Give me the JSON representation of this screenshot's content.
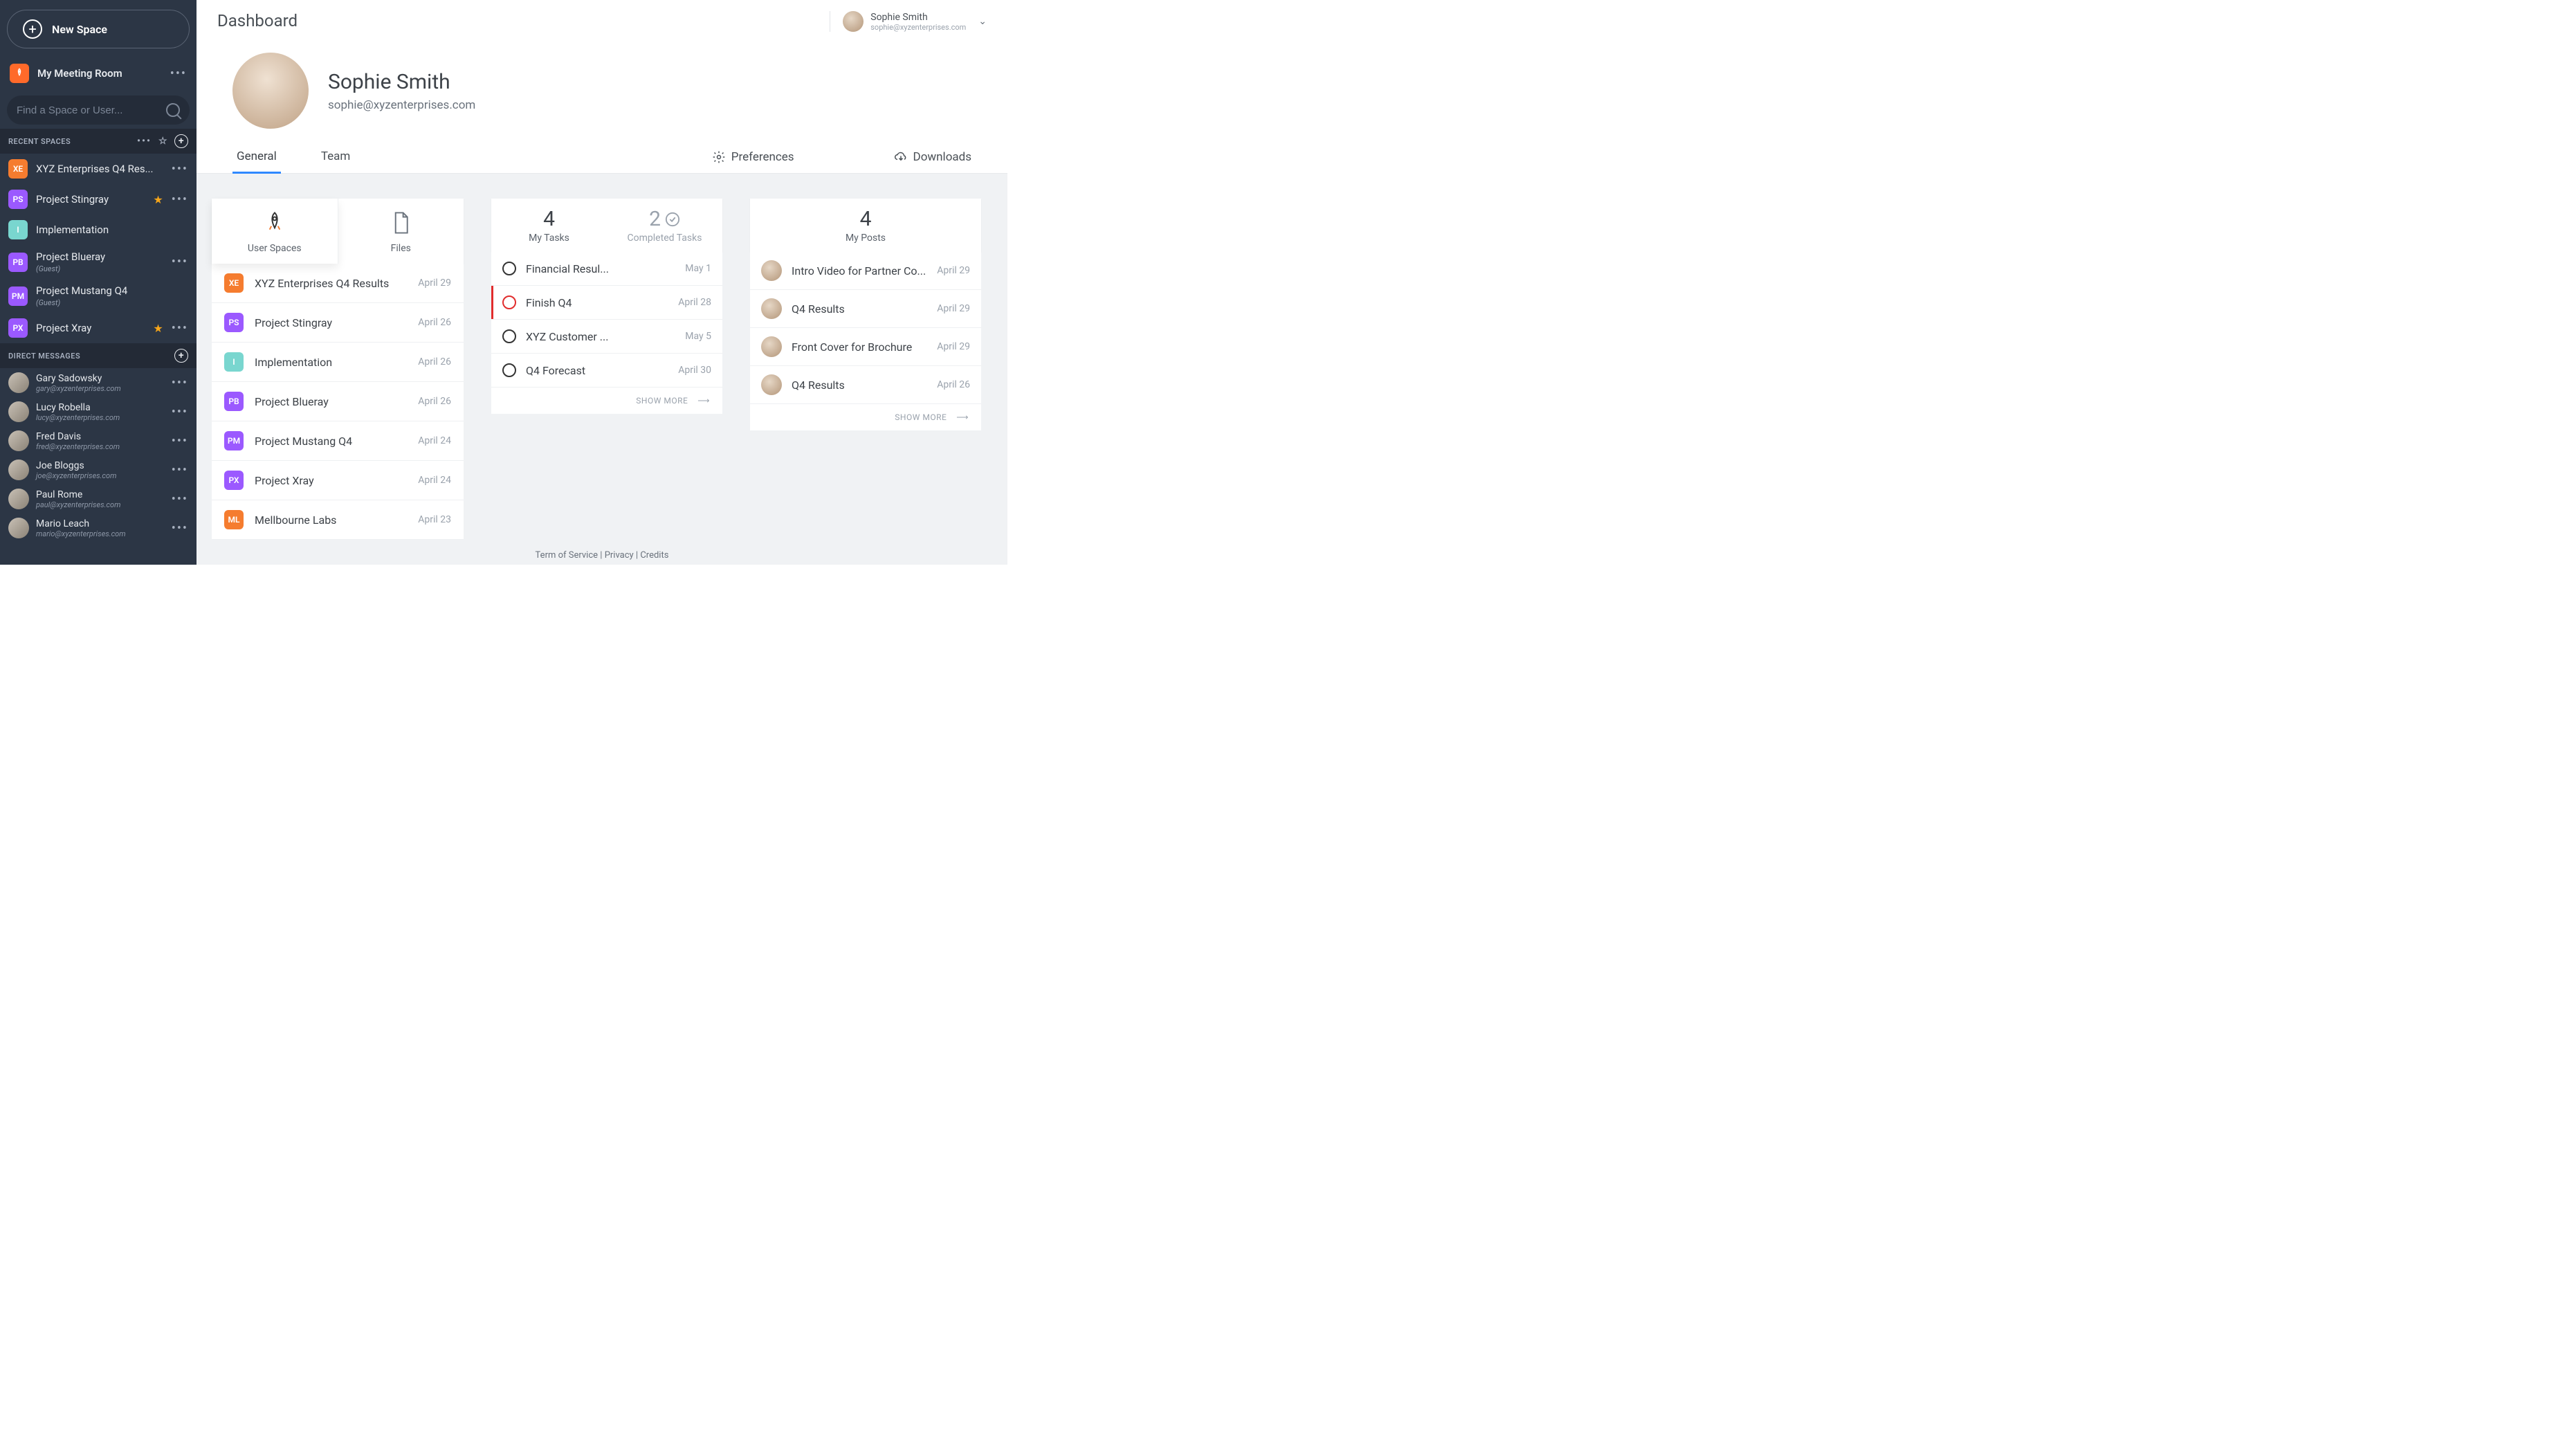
{
  "sidebar": {
    "new_space_label": "New Space",
    "my_meeting_room": "My Meeting Room",
    "search_placeholder": "Find a Space or User...",
    "recent_header": "RECENT SPACES",
    "dm_header": "DIRECT MESSAGES",
    "spaces": [
      {
        "code": "XE",
        "color": "#f57c2f",
        "name": "XYZ Enterprises Q4 Res...",
        "starred": false,
        "guest": false,
        "menu": true
      },
      {
        "code": "PS",
        "color": "#9b59ff",
        "name": "Project Stingray",
        "starred": true,
        "guest": false,
        "menu": true
      },
      {
        "code": "I",
        "color": "#79d6cf",
        "name": "Implementation",
        "starred": false,
        "guest": false,
        "menu": false
      },
      {
        "code": "PB",
        "color": "#9b59ff",
        "name": "Project Blueray",
        "starred": false,
        "guest": true,
        "menu": true
      },
      {
        "code": "PM",
        "color": "#9b59ff",
        "name": "Project Mustang Q4",
        "starred": false,
        "guest": true,
        "menu": false
      },
      {
        "code": "PX",
        "color": "#9b59ff",
        "name": "Project Xray",
        "starred": true,
        "guest": false,
        "menu": true
      }
    ],
    "guest_label": "(Guest)",
    "dms": [
      {
        "name": "Gary Sadowsky",
        "email": "gary@xyzenterprises.com"
      },
      {
        "name": "Lucy Robella",
        "email": "lucy@xyzenterprises.com"
      },
      {
        "name": "Fred Davis",
        "email": "fred@xyzenterprises.com"
      },
      {
        "name": "Joe Bloggs",
        "email": "joe@xyzenterprises.com"
      },
      {
        "name": "Paul Rome",
        "email": "paul@xyzenterprises.com"
      },
      {
        "name": "Mario Leach",
        "email": "mario@xyzenterprises.com"
      }
    ]
  },
  "header": {
    "page_title": "Dashboard",
    "user": {
      "name": "Sophie Smith",
      "email": "sophie@xyzenterprises.com"
    }
  },
  "profile": {
    "name": "Sophie Smith",
    "email": "sophie@xyzenterprises.com"
  },
  "tabs": {
    "general": "General",
    "team": "Team",
    "preferences": "Preferences",
    "downloads": "Downloads"
  },
  "col1": {
    "user_spaces_caption": "User Spaces",
    "files_caption": "Files",
    "rows": [
      {
        "code": "XE",
        "color": "#f57c2f",
        "name": "XYZ Enterprises Q4 Results",
        "date": "April 29"
      },
      {
        "code": "PS",
        "color": "#9b59ff",
        "name": "Project Stingray",
        "date": "April 26"
      },
      {
        "code": "I",
        "color": "#79d6cf",
        "name": "Implementation",
        "date": "April 26"
      },
      {
        "code": "PB",
        "color": "#9b59ff",
        "name": "Project Blueray",
        "date": "April 26"
      },
      {
        "code": "PM",
        "color": "#9b59ff",
        "name": "Project Mustang Q4",
        "date": "April 24"
      },
      {
        "code": "PX",
        "color": "#9b59ff",
        "name": "Project Xray",
        "date": "April 24"
      },
      {
        "code": "ML",
        "color": "#f57c2f",
        "name": "Mellbourne Labs",
        "date": "April 23"
      }
    ]
  },
  "col2": {
    "my_tasks_count": "4",
    "my_tasks_caption": "My Tasks",
    "completed_count": "2",
    "completed_caption": "Completed Tasks",
    "tasks": [
      {
        "name": "Financial Resul...",
        "date": "May 1",
        "hot": false
      },
      {
        "name": "Finish Q4",
        "date": "April 28",
        "hot": true
      },
      {
        "name": "XYZ Customer ...",
        "date": "May 5",
        "hot": false
      },
      {
        "name": "Q4 Forecast",
        "date": "April 30",
        "hot": false
      }
    ],
    "show_more": "SHOW MORE"
  },
  "col3": {
    "count": "4",
    "caption": "My Posts",
    "posts": [
      {
        "name": "Intro Video for Partner Co...",
        "date": "April 29"
      },
      {
        "name": "Q4 Results",
        "date": "April 29"
      },
      {
        "name": "Front Cover for Brochure",
        "date": "April 29"
      },
      {
        "name": "Q4 Results",
        "date": "April 26"
      }
    ],
    "show_more": "SHOW MORE"
  },
  "footer": {
    "tos": "Term of Service",
    "privacy": "Privacy",
    "credits": "Credits"
  }
}
